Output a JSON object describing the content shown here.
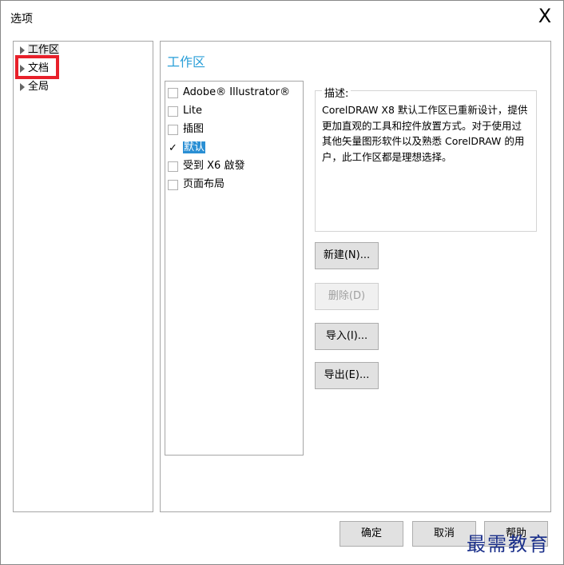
{
  "window": {
    "title": "选项",
    "close_glyph": "X"
  },
  "tree": {
    "items": [
      {
        "label": "工作区",
        "icon": "expand-arrow-icon"
      },
      {
        "label": "文档",
        "icon": "expand-arrow-icon"
      },
      {
        "label": "全局",
        "icon": "expand-arrow-icon"
      }
    ],
    "highlight_color": "#e8202a"
  },
  "content": {
    "title": "工作区",
    "title_color": "#2a9fd8",
    "workspaces": [
      {
        "label": "Adobe® Illustrator®",
        "checked": false
      },
      {
        "label": "Lite",
        "checked": false
      },
      {
        "label": "插图",
        "checked": false
      },
      {
        "label": "默认",
        "checked": true,
        "selected": true
      },
      {
        "label": "受到 X6 啟發",
        "checked": false
      },
      {
        "label": "页面布局",
        "checked": false
      }
    ],
    "description": {
      "legend": "描述:",
      "text": "CorelDRAW X8 默认工作区已重新设计，提供更加直观的工具和控件放置方式。对于使用过其他矢量图形软件以及熟悉 CorelDRAW 的用户，此工作区都是理想选择。"
    },
    "buttons": {
      "new": "新建(N)...",
      "delete": "删除(D)",
      "import": "导入(I)...",
      "export": "导出(E)..."
    }
  },
  "footer": {
    "ok": "确定",
    "cancel": "取消",
    "help": "帮助"
  },
  "watermark": "最需教育",
  "selection_color": "#2a8fd4"
}
